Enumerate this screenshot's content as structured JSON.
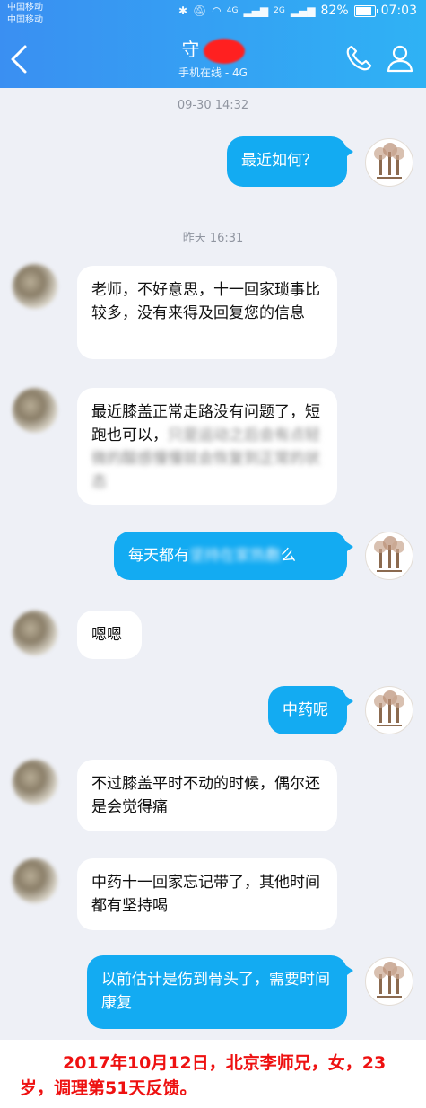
{
  "status_bar": {
    "carrier1": "中国移动",
    "carrier2": "中国移动",
    "signal1": "4G",
    "signal2": "2G",
    "battery": "82%",
    "time": "07:03"
  },
  "header": {
    "contact_name": "守",
    "contact_status": "手机在线 - 4G"
  },
  "timestamps": {
    "t1": "09-30 14:32",
    "t2": "昨天 16:31"
  },
  "messages": {
    "m1": "最近如何？",
    "m2": "老师，不好意思，十一回家琐事比较多，没有来得及回复您的信息",
    "m3_visible": "最近膝盖正常走路没有问题了，短跑也可以，",
    "m3_blurred": "只是运动之后会有点轻微的酸感慢慢就会恢复到正常的状态",
    "m4_prefix": "每天都有",
    "m4_blurred": "坚持在家热敷",
    "m4_suffix": "么",
    "m5": "嗯嗯",
    "m6": "中药呢",
    "m7": "不过膝盖平时不动的时候，偶尔还是会觉得痛",
    "m8": "中药十一回家忘记带了，其他时间都有坚持喝",
    "m9": "以前估计是伤到骨头了，需要时间康复"
  },
  "caption": "2017年10月12日，北京李师兄，女，23岁，调理第51天反馈。",
  "colors": {
    "header_start": "#3a8ff2",
    "header_end": "#2fb2f4",
    "outgoing_bubble": "#13abf2",
    "incoming_bubble": "#ffffff",
    "background": "#eef0f6",
    "caption_text": "#ee1111"
  }
}
